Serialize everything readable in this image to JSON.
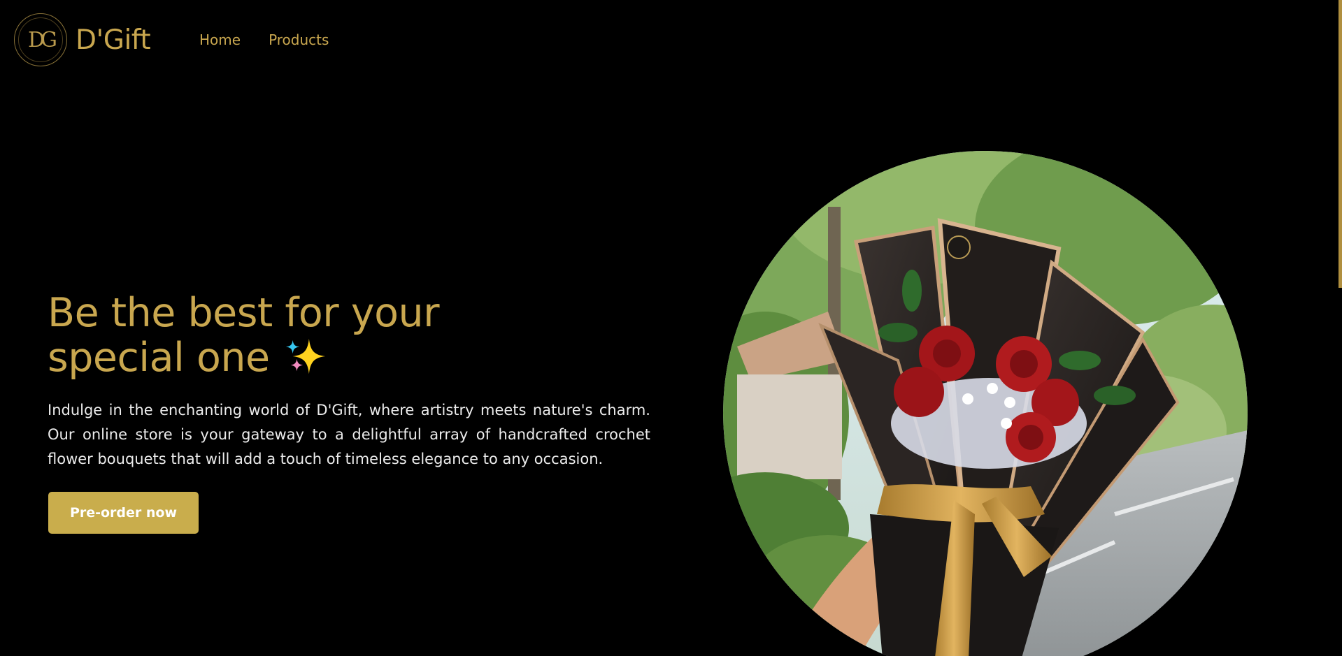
{
  "brand": {
    "logo_text": "DG",
    "name": "D'Gift"
  },
  "nav": {
    "items": [
      "Home",
      "Products"
    ]
  },
  "hero": {
    "title": "Be the best for your special one",
    "description": "Indulge in the enchanting world of D'Gift, where artistry meets nature's charm. Our online store is your gateway to a delightful array of handcrafted crochet flower bouquets that will add a touch of timeless elegance to any occasion.",
    "cta_label": "Pre-order now",
    "image_icon": "sparkles-icon"
  },
  "colors": {
    "background": "#000000",
    "accent_gold": "#c9a74f",
    "button_gold": "#c9ad4c",
    "text_light": "#ececec"
  }
}
